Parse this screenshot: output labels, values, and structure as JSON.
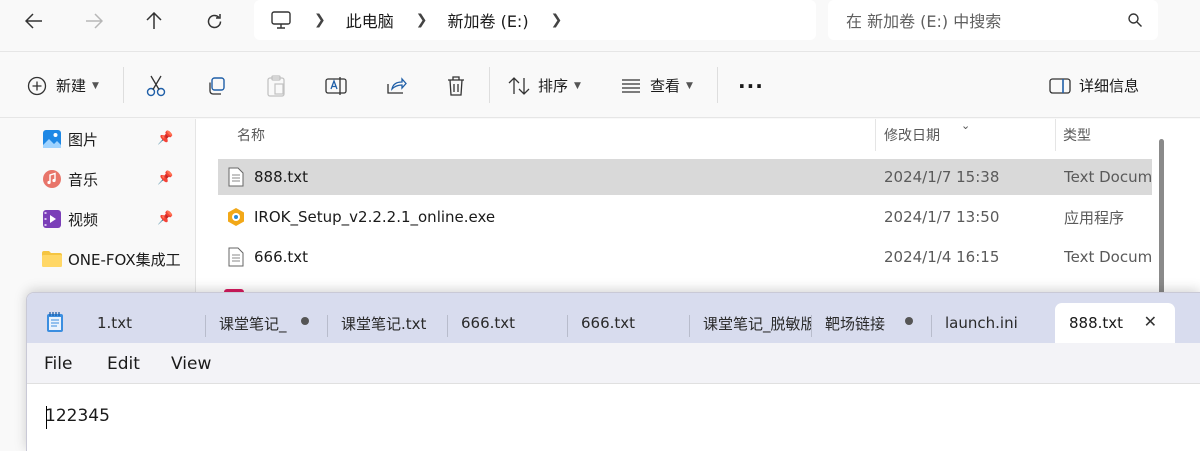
{
  "explorer": {
    "breadcrumb": [
      "此电脑",
      "新加卷 (E:)"
    ],
    "search_placeholder": "在 新加卷 (E:) 中搜索",
    "toolbar": {
      "new_label": "新建",
      "sort_label": "排序",
      "view_label": "查看",
      "more_label": "···",
      "details_label": "详细信息"
    },
    "sidebar": [
      {
        "label": "图片",
        "icon": "pictures-icon",
        "pinned": true
      },
      {
        "label": "音乐",
        "icon": "music-icon",
        "pinned": true
      },
      {
        "label": "视频",
        "icon": "videos-icon",
        "pinned": true
      },
      {
        "label": "ONE-FOX集成工",
        "icon": "folder-icon",
        "pinned": false
      }
    ],
    "columns": {
      "name": "名称",
      "modified": "修改日期",
      "type": "类型"
    },
    "files": [
      {
        "name": "888.txt",
        "date": "2024/1/7 15:38",
        "type": "Text Docum",
        "icon": "text-file-icon",
        "selected": true
      },
      {
        "name": "IROK_Setup_v2.2.2.1_online.exe",
        "date": "2024/1/7 13:50",
        "type": "应用程序",
        "icon": "exe-icon",
        "selected": false
      },
      {
        "name": "666.txt",
        "date": "2024/1/4 16:15",
        "type": "Text Docum",
        "icon": "text-file-icon",
        "selected": false
      }
    ]
  },
  "notepad": {
    "tabs": [
      {
        "label": "1.txt",
        "modified": false
      },
      {
        "label": "课堂笔记_",
        "modified": true
      },
      {
        "label": "课堂笔记.txt",
        "modified": false
      },
      {
        "label": "666.txt",
        "modified": false
      },
      {
        "label": "666.txt",
        "modified": false
      },
      {
        "label": "课堂笔记_脱敏版",
        "modified": false
      },
      {
        "label": "靶场链接",
        "modified": true
      },
      {
        "label": "launch.ini",
        "modified": false
      },
      {
        "label": "888.txt",
        "modified": false,
        "active": true
      }
    ],
    "menu": [
      "File",
      "Edit",
      "View"
    ],
    "content": "122345"
  }
}
